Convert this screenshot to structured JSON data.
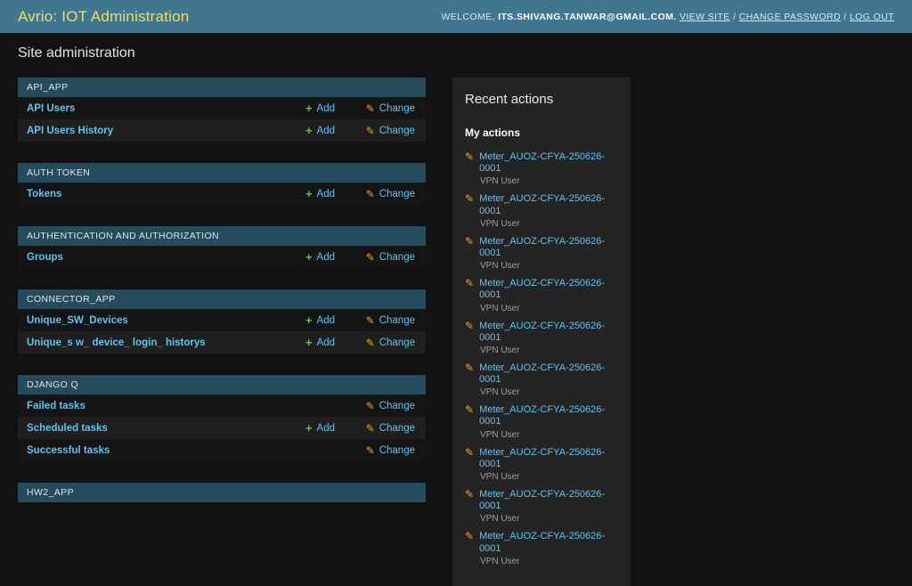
{
  "header": {
    "app_title": "Avrio: IOT Administration",
    "welcome_label": "WELCOME,",
    "user_email": "ITS.SHIVANG.TANWAR@GMAIL.COM.",
    "links": [
      "VIEW SITE",
      "CHANGE PASSWORD",
      "LOG OUT"
    ],
    "link_separator": "/"
  },
  "page": {
    "title": "Site administration"
  },
  "action_labels": {
    "add": "Add",
    "change": "Change"
  },
  "icons": {
    "add": "+",
    "pencil": "✎"
  },
  "modules": [
    {
      "caption": "API_APP",
      "rows": [
        {
          "label": "API Users",
          "add": true,
          "change": true
        },
        {
          "label": "API Users History",
          "add": true,
          "change": true
        }
      ]
    },
    {
      "caption": "AUTH TOKEN",
      "rows": [
        {
          "label": "Tokens",
          "add": true,
          "change": true
        }
      ]
    },
    {
      "caption": "AUTHENTICATION AND AUTHORIZATION",
      "rows": [
        {
          "label": "Groups",
          "add": true,
          "change": true
        }
      ]
    },
    {
      "caption": "CONNECTOR_APP",
      "rows": [
        {
          "label": "Unique_SW_Devices",
          "add": true,
          "change": true
        },
        {
          "label": "Unique_s w_ device_ login_ historys",
          "add": true,
          "change": true
        }
      ]
    },
    {
      "caption": "DJANGO Q",
      "rows": [
        {
          "label": "Failed tasks",
          "add": false,
          "change": true
        },
        {
          "label": "Scheduled tasks",
          "add": true,
          "change": true
        },
        {
          "label": "Successful tasks",
          "add": false,
          "change": true
        }
      ]
    },
    {
      "caption": "HW2_APP",
      "rows": []
    }
  ],
  "recent_actions": {
    "title": "Recent actions",
    "group_title": "My actions",
    "items": [
      {
        "label": "Meter_AUOZ-CFYA-250626-0001",
        "sublabel": "VPN User"
      },
      {
        "label": "Meter_AUOZ-CFYA-250626-0001",
        "sublabel": "VPN User"
      },
      {
        "label": "Meter_AUOZ-CFYA-250626-0001",
        "sublabel": "VPN User"
      },
      {
        "label": "Meter_AUOZ-CFYA-250626-0001",
        "sublabel": "VPN User"
      },
      {
        "label": "Meter_AUOZ-CFYA-250626-0001",
        "sublabel": "VPN User"
      },
      {
        "label": "Meter_AUOZ-CFYA-250626-0001",
        "sublabel": "VPN User"
      },
      {
        "label": "Meter_AUOZ-CFYA-250626-0001",
        "sublabel": "VPN User"
      },
      {
        "label": "Meter_AUOZ-CFYA-250626-0001",
        "sublabel": "VPN User"
      },
      {
        "label": "Meter_AUOZ-CFYA-250626-0001",
        "sublabel": "VPN User"
      },
      {
        "label": "Meter_AUOZ-CFYA-250626-0001",
        "sublabel": "VPN User"
      }
    ]
  },
  "colors": {
    "header_bg": "#417690",
    "title_yellow": "#f5dd5d",
    "caption_bg": "#264b5d",
    "page_bg": "#121212",
    "panel_bg": "#242424",
    "link_blue": "#63c1f0",
    "add_green": "#6abf44",
    "pencil_gold": "#e7a62a",
    "row_dark": "#151515",
    "row_light": "#1f1f1f"
  }
}
